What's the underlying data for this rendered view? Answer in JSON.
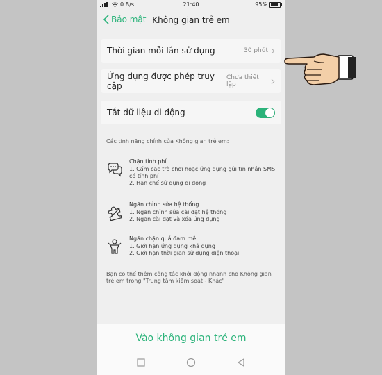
{
  "status_bar": {
    "network_speed": "0 B/s",
    "time": "21:40",
    "battery": "95%"
  },
  "header": {
    "back_label": "Bảo mật",
    "title": "Không gian trẻ em"
  },
  "settings": {
    "time_per_use": {
      "label": "Thời gian mỗi lần sử dụng",
      "value": "30 phút"
    },
    "allowed_apps": {
      "label": "Ứng dụng được phép truy cập",
      "value": "Chưa thiết lập"
    },
    "mobile_data": {
      "label": "Tắt dữ liệu di động",
      "enabled": true
    }
  },
  "features": {
    "caption": "Các tính năng chính của Không gian trẻ em:",
    "items": [
      {
        "icon": "chat-bubbles-icon",
        "title": "Chặn tính phí",
        "line1": "1. Cấm các trò chơi hoặc ứng dụng gửi tin nhắn SMS có tính phí",
        "line2": "2. Hạn chế sử dụng di động"
      },
      {
        "icon": "puzzle-block-icon",
        "title": "Ngăn chỉnh sửa hệ thống",
        "line1": "1. Ngăn chỉnh sửa cài đặt hệ thống",
        "line2": "2. Ngăn cài đặt và xóa ứng dụng"
      },
      {
        "icon": "child-figure-icon",
        "title": "Ngăn chặn quá đam mê",
        "line1": "1. Giới hạn ứng dụng khả dụng",
        "line2": "2. Giới hạn thời gian sử dụng điện thoại"
      }
    ]
  },
  "footnote": "Bạn có thể thêm công tắc khởi động nhanh cho Không gian trẻ em trong \"Trung tâm kiểm soát - Khác\"",
  "enter_button": "Vào không gian trẻ em",
  "colors": {
    "accent": "#2bb37a",
    "background": "#efefef",
    "card": "#f6f6f6"
  }
}
